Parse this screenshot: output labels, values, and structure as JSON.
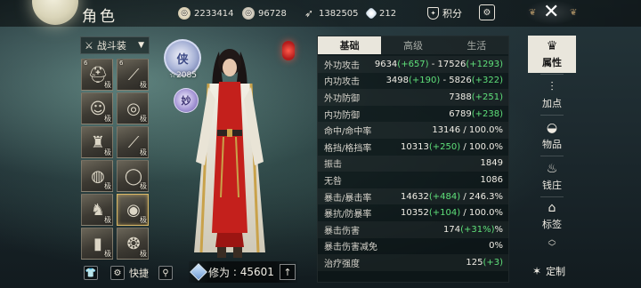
{
  "header": {
    "title": "角色",
    "currencies": [
      {
        "icon": "coin-icon",
        "value": "2233414"
      },
      {
        "icon": "silver-coin-icon",
        "value": "96728"
      },
      {
        "icon": "feather-icon",
        "value": "1382505"
      },
      {
        "icon": "gem-icon",
        "value": "212"
      }
    ],
    "points_label": "积分",
    "close_symbol": "✕"
  },
  "equipment": {
    "set_label": "战斗装",
    "slot_tag": "极",
    "slots": [
      {
        "name": "helmet-slot",
        "icon": "hat-icon",
        "glyph": "⛑",
        "level": "6"
      },
      {
        "name": "weapon-slot",
        "icon": "spear-icon",
        "glyph": "⟋",
        "level": "6"
      },
      {
        "name": "portrait-slot",
        "icon": "face-icon",
        "glyph": "☺",
        "level": ""
      },
      {
        "name": "bracelet-slot",
        "icon": "bracelet-icon",
        "glyph": "◎",
        "level": ""
      },
      {
        "name": "armor-slot",
        "icon": "robe-icon",
        "glyph": "♜",
        "level": ""
      },
      {
        "name": "dagger-slot",
        "icon": "dagger-icon",
        "glyph": "⟋",
        "level": ""
      },
      {
        "name": "belt-slot",
        "icon": "belt-icon",
        "glyph": "◍",
        "level": ""
      },
      {
        "name": "ring-slot",
        "icon": "ring-icon",
        "glyph": "◯",
        "level": ""
      },
      {
        "name": "cape-slot",
        "icon": "cape-icon",
        "glyph": "♞",
        "level": ""
      },
      {
        "name": "amulet-slot",
        "icon": "amulet-icon",
        "glyph": "◉",
        "level": ""
      },
      {
        "name": "boots-slot",
        "icon": "boots-icon",
        "glyph": "▮",
        "level": ""
      },
      {
        "name": "charm-slot",
        "icon": "charm-icon",
        "glyph": "❂",
        "level": ""
      }
    ],
    "quick_label": "快捷",
    "cultivation_label": "修为",
    "cultivation_value": "45601"
  },
  "badges": {
    "rank_text": "侠",
    "rank_number": "2085",
    "sub_text": "妙"
  },
  "stats": {
    "tabs": [
      "基础",
      "高级",
      "生活"
    ],
    "rows": [
      {
        "label": "外功攻击",
        "parts": [
          "9634",
          "(+657)",
          " - 17526",
          "(+1293)"
        ]
      },
      {
        "label": "内功攻击",
        "parts": [
          "3498",
          "(+190)",
          " - 5826",
          "(+322)"
        ]
      },
      {
        "label": "外功防御",
        "parts": [
          "7388",
          "(+251)",
          "",
          ""
        ]
      },
      {
        "label": "内功防御",
        "parts": [
          "6789",
          "(+238)",
          "",
          ""
        ]
      },
      {
        "label": "命中/命中率",
        "parts": [
          "13146 / 100.0%",
          "",
          "",
          ""
        ]
      },
      {
        "label": "格挡/格挡率",
        "parts": [
          "10313",
          "(+250)",
          " / 100.0%",
          ""
        ]
      },
      {
        "label": "振击",
        "parts": [
          "1849",
          "",
          "",
          ""
        ]
      },
      {
        "label": "无咎",
        "parts": [
          "1086",
          "",
          "",
          ""
        ]
      },
      {
        "label": "暴击/暴击率",
        "parts": [
          "14632",
          "(+484)",
          " / 246.3%",
          ""
        ]
      },
      {
        "label": "暴抗/防暴率",
        "parts": [
          "10352",
          "(+104)",
          " / 100.0%",
          ""
        ]
      },
      {
        "label": "暴击伤害",
        "parts": [
          "174",
          "(+31%)",
          "%",
          ""
        ]
      },
      {
        "label": "暴击伤害减免",
        "parts": [
          "0%",
          "",
          "",
          ""
        ]
      },
      {
        "label": "治疗强度",
        "parts": [
          "125",
          "(+3)",
          "",
          ""
        ]
      }
    ]
  },
  "nav": {
    "items": [
      {
        "label": "属性",
        "icon": "scholar-hat-icon",
        "glyph": "🎓"
      },
      {
        "label": "加点",
        "icon": "sliders-icon",
        "glyph": "⫶"
      },
      {
        "label": "物品",
        "icon": "bag-icon",
        "glyph": "◒"
      },
      {
        "label": "钱庄",
        "icon": "money-bag-icon",
        "glyph": "♨"
      },
      {
        "label": "标签",
        "icon": "tag-icon",
        "glyph": "⌂"
      }
    ],
    "custom_label": "定制"
  },
  "colors": {
    "bonus_green": "#5fe07a",
    "active_tab": "#e9e6dc"
  }
}
